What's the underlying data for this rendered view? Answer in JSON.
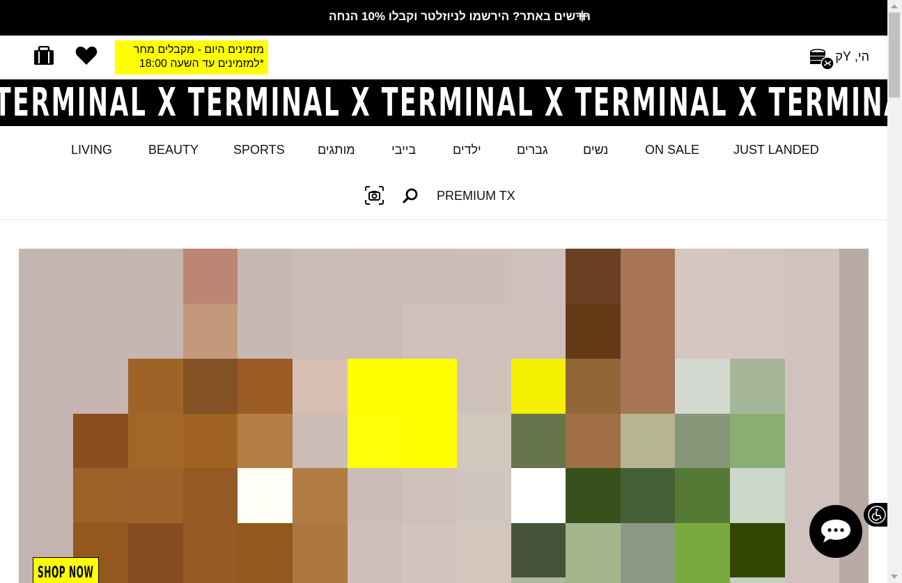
{
  "topbar": {
    "promo_text": "חדשים באתר? הירשמו לניוזלטר וקבלו 10% הנחה",
    "expand_icon": "plus-icon"
  },
  "header": {
    "delivery_line1": "מזמינים היום - מקבלים מחר",
    "delivery_line2": "*למזמינים עד השעה 18:00",
    "greeting": "הי, Yק",
    "icons": [
      "shopping-bag-icon",
      "heart-icon",
      "coins-flight-icon"
    ]
  },
  "brand": {
    "marquee_text": "TERMINAL X TERMINAL X TERMINAL X TERMINAL X TERMINAL X TERMINAL X TERMINAL X"
  },
  "nav": {
    "row1": [
      "LIVING",
      "BEAUTY",
      "SPORTS",
      "מותגים",
      "בייבי",
      "ילדים",
      "גברים",
      "נשים",
      "ON SALE",
      "JUST LANDED"
    ],
    "row2": [
      "PREMIUM TX"
    ],
    "icons": [
      "camera-search-icon",
      "search-icon"
    ]
  },
  "hero": {
    "cta_label": "SHOP NOW"
  },
  "widgets": {
    "accessibility_icon": "wheelchair-icon",
    "chat_icon": "chat-bubble-icon"
  },
  "colors": {
    "accent_yellow": "#ffff00",
    "black": "#000000"
  }
}
